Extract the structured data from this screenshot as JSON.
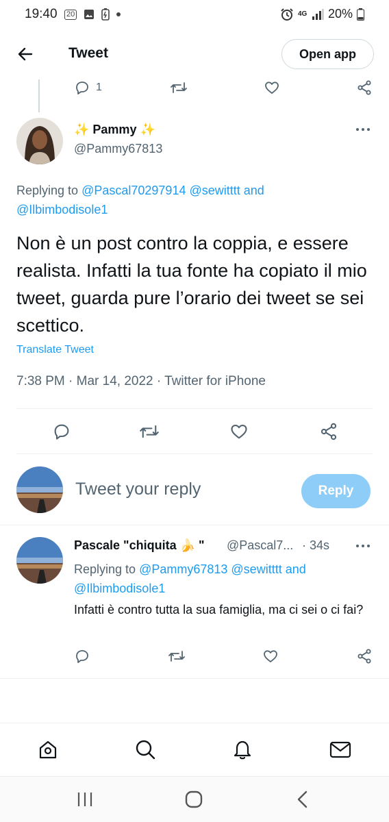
{
  "status_bar": {
    "time": "19:40",
    "battery": "20%",
    "notif_badge": "20",
    "network": "4G"
  },
  "header": {
    "title": "Tweet",
    "open_app": "Open app"
  },
  "prev_tweet_actions": {
    "reply_count": "1"
  },
  "tweet": {
    "display_name": "✨ Pammy ✨",
    "handle": "@Pammy67813",
    "replying_prefix": "Replying to",
    "replying_handles": "@Pascal70297914 @sewitttt",
    "replying_and": "and",
    "replying_handle2": "@Ilbimbodisole1",
    "text": "Non è un post contro la coppia,  e essere realista. Infatti la tua fonte ha copiato il mio tweet, guarda pure l’orario dei tweet se sei scettico.",
    "translate": "Translate Tweet",
    "meta": "7:38 PM · Mar 14, 2022 · Twitter for iPhone"
  },
  "reply_box": {
    "placeholder": "Tweet your reply",
    "button": "Reply"
  },
  "reply": {
    "display_name": "Pascale \"chiquita 🍌 \"",
    "handle": "@Pascal7...",
    "time": "· 34s",
    "replying_prefix": "Replying to",
    "replying_handles": "@Pammy67813 @sewitttt",
    "replying_and": "and",
    "replying_handle2": "@Ilbimbodisole1",
    "text": "Infatti è contro tutta la sua famiglia, ma ci sei o ci fai?"
  },
  "colors": {
    "accent": "#1d9bf0",
    "reply_button": "#8ecdf7",
    "secondary_text": "#536471"
  },
  "icons": [
    "back-arrow-icon",
    "reply-icon",
    "retweet-icon",
    "like-icon",
    "share-icon",
    "more-icon",
    "home-icon",
    "search-icon",
    "notifications-icon",
    "messages-icon"
  ]
}
